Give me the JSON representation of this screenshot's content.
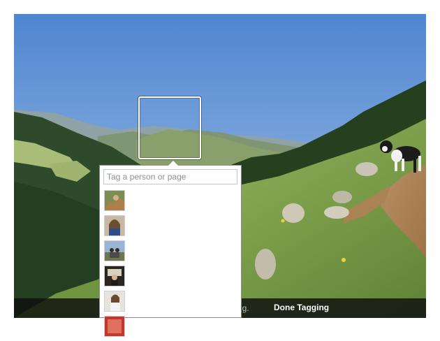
{
  "tagging": {
    "input_placeholder": "Tag a person or page",
    "suggestions": [
      {
        "thumbnail": "person-photo-thumbnail"
      },
      {
        "thumbnail": "person-photo-thumbnail"
      },
      {
        "thumbnail": "person-photo-thumbnail"
      },
      {
        "thumbnail": "person-photo-thumbnail"
      },
      {
        "thumbnail": "person-photo-thumbnail"
      },
      {
        "thumbnail": "person-photo-thumbnail"
      }
    ]
  },
  "bottom_bar": {
    "hint_fragment": "ng.",
    "done_label": "Done Tagging"
  },
  "colors": {
    "sky": "#5f92d4",
    "grass": "#7da24a",
    "forest": "#2f4d28",
    "bar": "#0f0f0f",
    "input_border": "#bdc7d8"
  }
}
